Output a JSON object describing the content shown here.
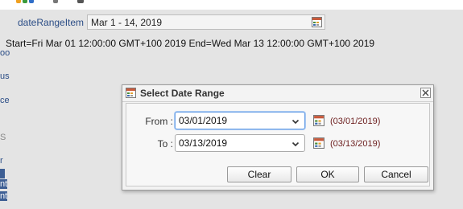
{
  "page": {
    "field_label": "dateRangeItem :",
    "field_value": "Mar 1 - 14, 2019",
    "result_text": "Start=Fri Mar 01 12:00:00 GMT+100 2019 End=Wed Mar 13 12:00:00 GMT+100 2019",
    "edge_fragments": [
      "oo",
      "us",
      "ce",
      "S",
      "r",
      "nt",
      "nt"
    ]
  },
  "dialog": {
    "title": "Select Date Range",
    "from": {
      "label": "From :",
      "value": "03/01/2019",
      "display": "(03/01/2019)"
    },
    "to": {
      "label": "To :",
      "value": "03/13/2019",
      "display": "(03/13/2019)"
    },
    "buttons": {
      "clear": "Clear",
      "ok": "OK",
      "cancel": "Cancel"
    }
  },
  "colors": {
    "label_blue": "#2b4d86",
    "date_text": "#6b1d1d",
    "focus_ring": "#6aa0e6"
  },
  "icons": {
    "picker": "calendar-icon",
    "dialog": "calendar-icon",
    "close": "close-icon",
    "dropdown": "chevron-down-icon"
  }
}
